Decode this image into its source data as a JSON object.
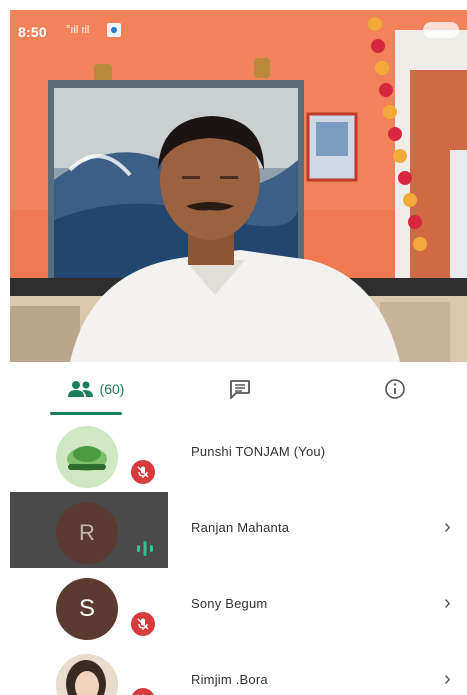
{
  "status_bar": {
    "time": "8:50",
    "signal_text": "°ıil ıil"
  },
  "tabs": {
    "participants_count": "(60)",
    "items": [
      {
        "name": "participants",
        "icon": "people-icon"
      },
      {
        "name": "chat",
        "icon": "chat-icon"
      },
      {
        "name": "info",
        "icon": "info-icon"
      }
    ]
  },
  "participants": [
    {
      "name": "Punshi TONJAM (You)",
      "avatar_type": "logo",
      "muted": true,
      "chevron": false
    },
    {
      "name": "Ranjan Mahanta",
      "avatar_letter": "R",
      "muted": false,
      "speaking": true,
      "chevron": true
    },
    {
      "name": "Sony Begum",
      "avatar_letter": "S",
      "muted": true,
      "chevron": true
    },
    {
      "name": "Rimjim .Bora",
      "avatar_type": "photo",
      "muted": true,
      "chevron": true
    }
  ],
  "colors": {
    "accent": "#1a7f59",
    "mute_badge": "#d63b3b",
    "speaking": "#2ec493",
    "active_row": "#4a4a4a"
  }
}
